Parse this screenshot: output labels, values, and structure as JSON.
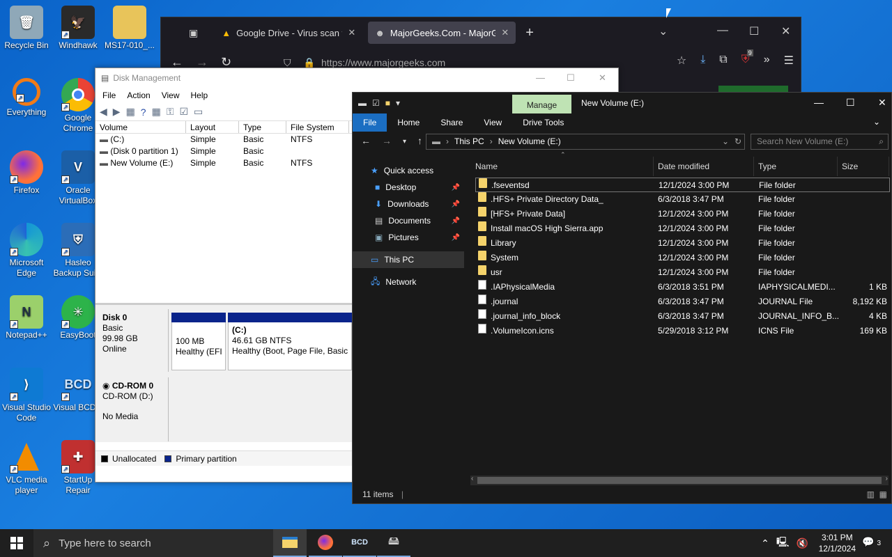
{
  "desktop": {
    "icons": [
      {
        "label": "Recycle Bin",
        "color": "#9ab"
      },
      {
        "label": "Windhawk",
        "color": "#333"
      },
      {
        "label": "MS17-010_...",
        "color": "#e8c45a"
      },
      {
        "label": "Everything",
        "color": "#f07b18"
      },
      {
        "label": "Google Chrome",
        "color": "#4285f4"
      },
      {
        "label": "Firefox",
        "color": "#ff7139"
      },
      {
        "label": "Oracle VirtualBox",
        "color": "#1b5fa7"
      },
      {
        "label": "Microsoft Edge",
        "color": "#1496d6"
      },
      {
        "label": "Hasleo Backup Sui...",
        "color": "#2b6db8"
      },
      {
        "label": "Notepad++",
        "color": "#6aa84f"
      },
      {
        "label": "EasyBoot",
        "color": "#2db34a"
      },
      {
        "label": "Visual Studio Code",
        "color": "#0e7ad3"
      },
      {
        "label": "Visual BCD...",
        "color": "#2a7ad0"
      },
      {
        "label": "VLC media player",
        "color": "#f28c00"
      },
      {
        "label": "StartUp Repair",
        "color": "#c03030"
      }
    ]
  },
  "browser": {
    "tabs": [
      {
        "label": "Google Drive - Virus scan warni"
      },
      {
        "label": "MajorGeeks.Com - MajorGeeks"
      }
    ],
    "new_tab": "+",
    "url": "https://www.majorgeeks.com",
    "badge": "9"
  },
  "disk_management": {
    "title": "Disk Management",
    "menu": [
      "File",
      "Action",
      "View",
      "Help"
    ],
    "columns": [
      "Volume",
      "Layout",
      "Type",
      "File System"
    ],
    "rows": [
      {
        "volume": "(C:)",
        "layout": "Simple",
        "type": "Basic",
        "fs": "NTFS"
      },
      {
        "volume": "(Disk 0 partition 1)",
        "layout": "Simple",
        "type": "Basic",
        "fs": ""
      },
      {
        "volume": "New Volume (E:)",
        "layout": "Simple",
        "type": "Basic",
        "fs": "NTFS"
      }
    ],
    "disk0": {
      "name": "Disk 0",
      "kind": "Basic",
      "size": "99.98 GB",
      "state": "Online"
    },
    "part1": {
      "size": "100 MB",
      "status": "Healthy (EFI"
    },
    "part2": {
      "name": "(C:)",
      "size": "46.61 GB NTFS",
      "status": "Healthy (Boot, Page File, Basic Da"
    },
    "cdrom": {
      "name": "CD-ROM 0",
      "kind": "CD-ROM (D:)",
      "media": "No Media"
    },
    "legend": {
      "unallocated": "Unallocated",
      "primary": "Primary partition"
    }
  },
  "explorer": {
    "manage": "Manage",
    "title": "New Volume (E:)",
    "ribbon": [
      "File",
      "Home",
      "Share",
      "View",
      "Drive Tools"
    ],
    "breadcrumb": [
      "This PC",
      "New Volume (E:)"
    ],
    "search_placeholder": "Search New Volume (E:)",
    "nav": [
      {
        "label": "Quick access",
        "pin": false
      },
      {
        "label": "Desktop",
        "pin": true
      },
      {
        "label": "Downloads",
        "pin": true
      },
      {
        "label": "Documents",
        "pin": true
      },
      {
        "label": "Pictures",
        "pin": true
      },
      {
        "label": "This PC",
        "pin": false
      },
      {
        "label": "Network",
        "pin": false
      }
    ],
    "columns": [
      "Name",
      "Date modified",
      "Type",
      "Size"
    ],
    "files": [
      {
        "name": ".fseventsd",
        "date": "12/1/2024 3:00 PM",
        "type": "File folder",
        "size": "",
        "folder": true
      },
      {
        "name": ".HFS+ Private Directory Data_",
        "date": "6/3/2018 3:47 PM",
        "type": "File folder",
        "size": "",
        "folder": true
      },
      {
        "name": "[HFS+ Private Data]",
        "date": "12/1/2024 3:00 PM",
        "type": "File folder",
        "size": "",
        "folder": true
      },
      {
        "name": "Install macOS High Sierra.app",
        "date": "12/1/2024 3:00 PM",
        "type": "File folder",
        "size": "",
        "folder": true
      },
      {
        "name": "Library",
        "date": "12/1/2024 3:00 PM",
        "type": "File folder",
        "size": "",
        "folder": true
      },
      {
        "name": "System",
        "date": "12/1/2024 3:00 PM",
        "type": "File folder",
        "size": "",
        "folder": true
      },
      {
        "name": "usr",
        "date": "12/1/2024 3:00 PM",
        "type": "File folder",
        "size": "",
        "folder": true
      },
      {
        "name": ".IAPhysicalMedia",
        "date": "6/3/2018 3:51 PM",
        "type": "IAPHYSICALMEDI...",
        "size": "1 KB",
        "folder": false
      },
      {
        "name": ".journal",
        "date": "6/3/2018 3:47 PM",
        "type": "JOURNAL File",
        "size": "8,192 KB",
        "folder": false
      },
      {
        "name": ".journal_info_block",
        "date": "6/3/2018 3:47 PM",
        "type": "JOURNAL_INFO_B...",
        "size": "4 KB",
        "folder": false
      },
      {
        "name": ".VolumeIcon.icns",
        "date": "5/29/2018 3:12 PM",
        "type": "ICNS File",
        "size": "169 KB",
        "folder": false
      }
    ],
    "status": "11 items"
  },
  "taskbar": {
    "search_placeholder": "Type here to search",
    "bcd_label": "BCD",
    "time": "3:01 PM",
    "date": "12/1/2024",
    "notif_count": "3"
  }
}
